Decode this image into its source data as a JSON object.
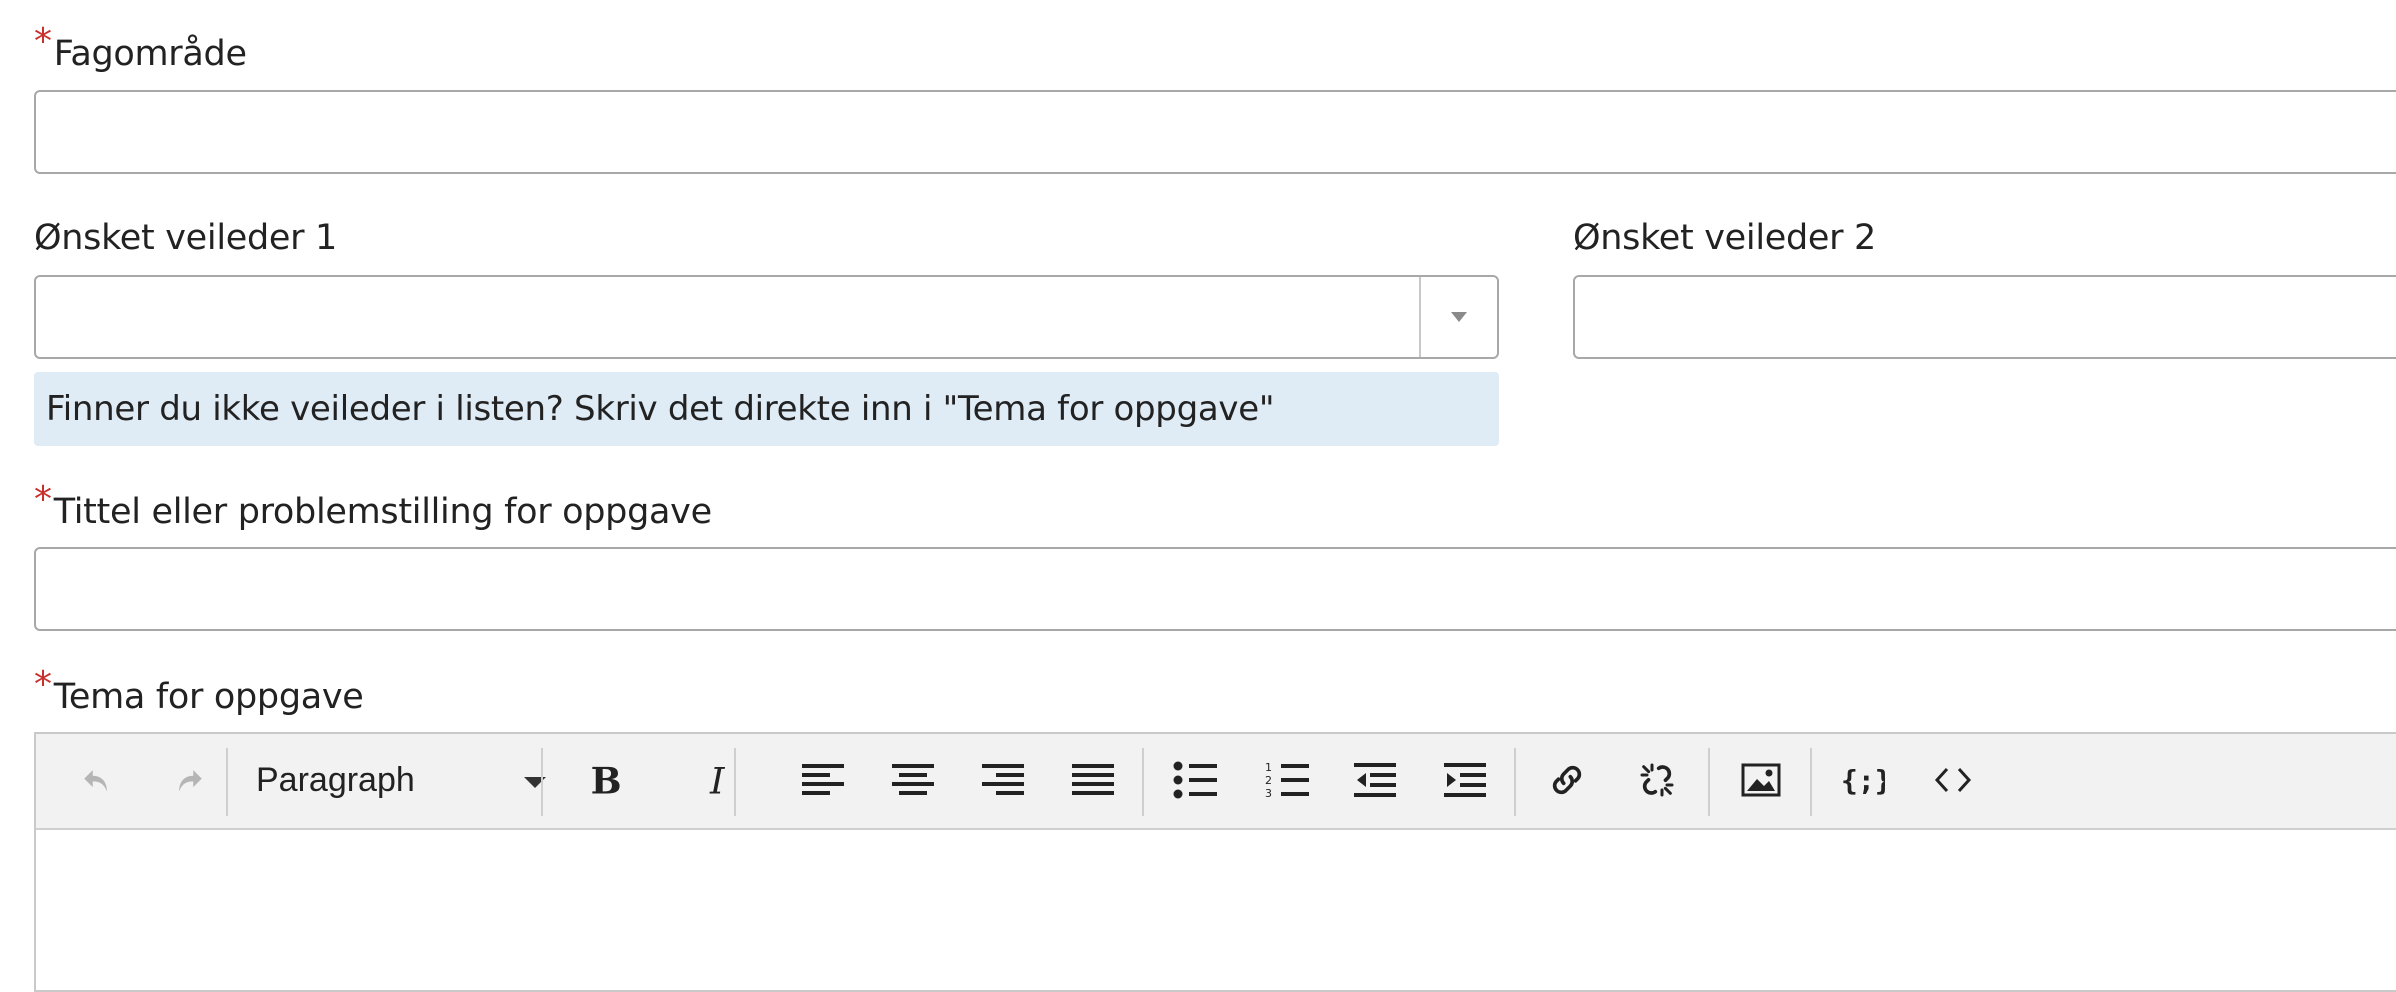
{
  "fields": {
    "fagomrade": {
      "label": "Fagområde",
      "required_mark": "*",
      "value": ""
    },
    "veileder1": {
      "label": "Ønsket veileder 1",
      "value": ""
    },
    "veileder2": {
      "label": "Ønsket veileder 2",
      "value": ""
    },
    "hint": "Finner du ikke veileder i listen? Skriv det direkte inn i \"Tema for oppgave\"",
    "tittel": {
      "label": "Tittel eller problemstilling for oppgave",
      "required_mark": "*",
      "value": ""
    },
    "tema": {
      "label": "Tema for oppgave",
      "required_mark": "*"
    }
  },
  "editor": {
    "format_select": "Paragraph",
    "toolbar_icons": [
      "undo-icon",
      "redo-icon",
      "bold-icon",
      "italic-icon",
      "align-left-icon",
      "align-center-icon",
      "align-right-icon",
      "justify-icon",
      "bullet-list-icon",
      "numbered-list-icon",
      "outdent-icon",
      "indent-icon",
      "link-icon",
      "unlink-icon",
      "image-icon",
      "code-sample-icon",
      "source-code-icon"
    ],
    "content": ""
  },
  "colors": {
    "required": "#c9302c",
    "hint_bg": "#dfecf6",
    "toolbar_bg": "#f2f2f2",
    "border": "#a8a8a8"
  }
}
